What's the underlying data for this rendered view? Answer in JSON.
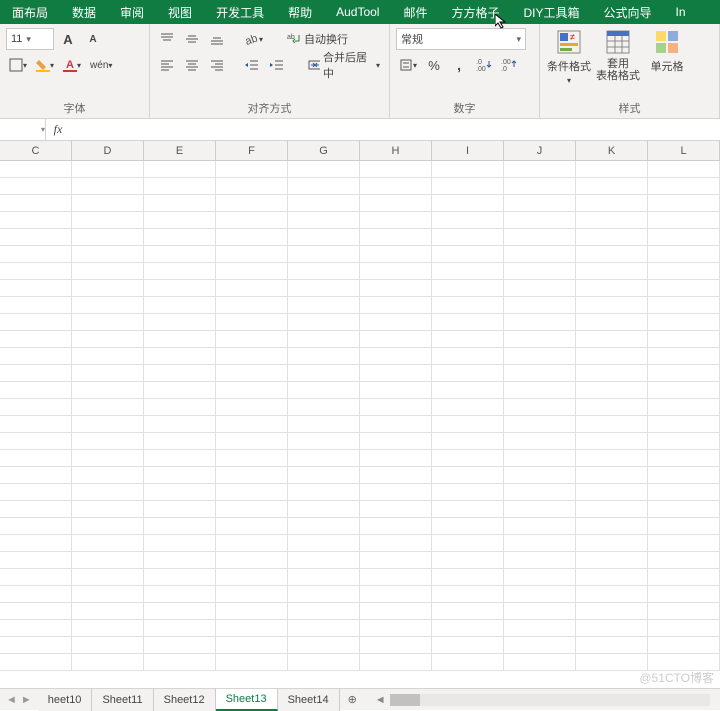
{
  "menu": {
    "tabs": [
      "面布局",
      "数据",
      "审阅",
      "视图",
      "开发工具",
      "帮助",
      "AudTool",
      "邮件",
      "方方格子",
      "DIY工具箱",
      "公式向导",
      "In"
    ]
  },
  "ribbon": {
    "font": {
      "label": "字体",
      "size": "11",
      "increase_hint": "A",
      "decrease_hint": "A",
      "wen": "wén"
    },
    "alignment": {
      "label": "对齐方式",
      "wrap": "自动换行",
      "merge": "合并后居中"
    },
    "number": {
      "label": "数字",
      "format": "常规",
      "percent": "%"
    },
    "styles": {
      "label": "样式",
      "conditional": "条件格式",
      "table_format": "套用\n表格格式",
      "cell_styles": "单元格"
    }
  },
  "formula": {
    "fx": "fx",
    "value": ""
  },
  "columns": [
    "C",
    "D",
    "E",
    "F",
    "G",
    "H",
    "I",
    "J",
    "K",
    "L"
  ],
  "grid": {
    "rows": 30,
    "cols": 10
  },
  "sheets": {
    "tabs": [
      "heet10",
      "Sheet11",
      "Sheet12",
      "Sheet13",
      "Sheet14"
    ],
    "active": 3,
    "add": "+"
  },
  "watermark": "@51CTO博客"
}
